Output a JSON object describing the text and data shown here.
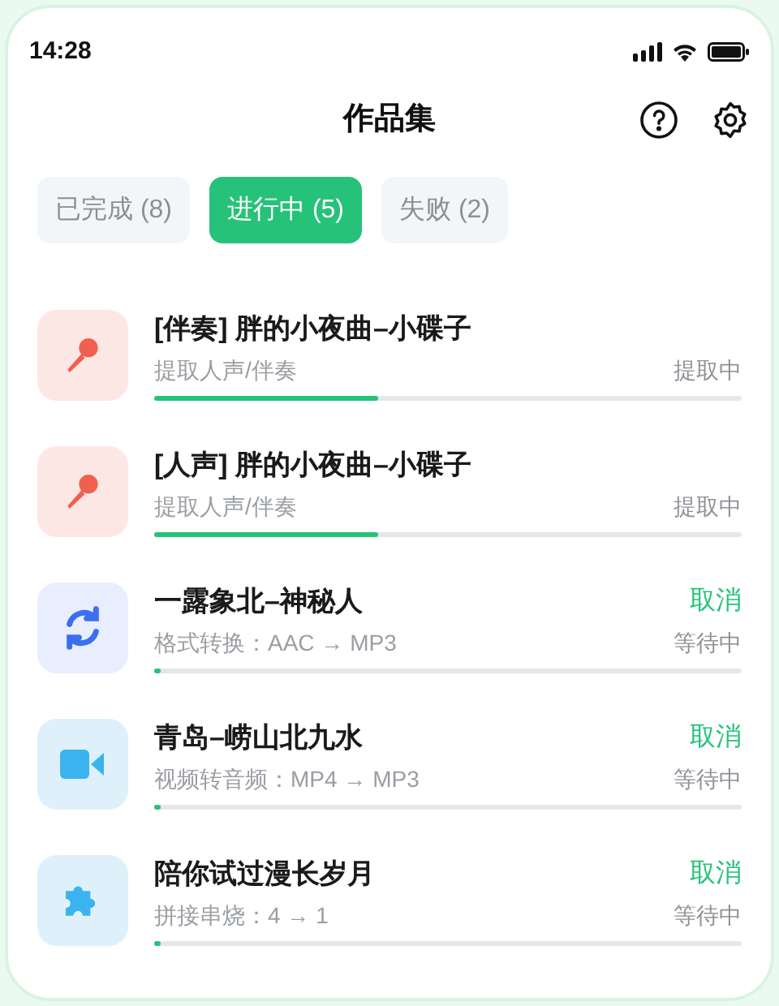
{
  "status_bar": {
    "time": "14:28"
  },
  "header": {
    "title": "作品集"
  },
  "tabs": [
    {
      "label": "已完成 (8)",
      "selected": false
    },
    {
      "label": "进行中 (5)",
      "selected": true
    },
    {
      "label": "失败 (2)",
      "selected": false
    }
  ],
  "tasks": [
    {
      "kind": "mic",
      "title": "[伴奏] 胖的小夜曲–小碟子",
      "detail": "提取人声/伴奏",
      "status": "提取中",
      "level": 0.38
    },
    {
      "kind": "mic",
      "title": "[人声] 胖的小夜曲–小碟子",
      "detail": "提取人声/伴奏",
      "status": "提取中",
      "level": 0.38
    },
    {
      "kind": "convert",
      "title": "一露象北–神秘人",
      "detail": "格式转换：AAC → MP3",
      "status": "等待中",
      "action": "取消",
      "level": 0.01
    },
    {
      "kind": "video",
      "title": "青岛–崂山北九水",
      "detail": "视频转音频：MP4 → MP3",
      "status": "等待中",
      "action": "取消",
      "level": 0.01
    },
    {
      "kind": "puzzle",
      "title": "陪你试过漫长岁月",
      "detail": "拼接串烧：4 → 1",
      "status": "等待中",
      "action": "取消",
      "level": 0.01
    }
  ]
}
